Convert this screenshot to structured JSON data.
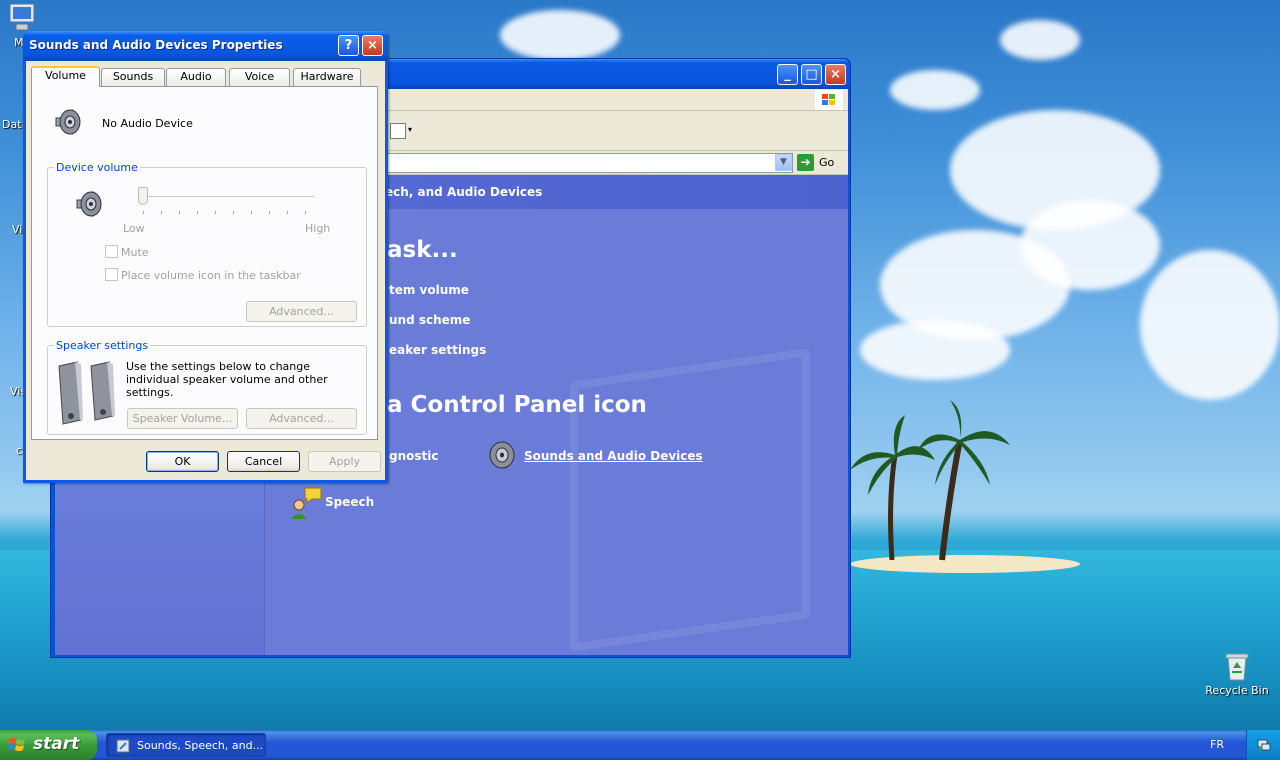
{
  "desktop": {
    "icons": [
      {
        "label": "My",
        "icon": "my-computer-icon"
      },
      {
        "label": "Dat",
        "icon": "data-icon"
      },
      {
        "label": "M\nVi",
        "icon": "folder-icon"
      },
      {
        "label": "M\nVis",
        "icon": "folder-icon"
      },
      {
        "label": "c",
        "icon": "shortcut-icon"
      }
    ],
    "recycle_bin": {
      "label": "Recycle Bin",
      "icon": "recycle-bin-icon"
    }
  },
  "control_panel": {
    "header": "ech, and Audio Devices",
    "pick_task_heading": "ask...",
    "tasks": [
      "tem volume",
      "und scheme",
      "eaker settings"
    ],
    "pick_icon_heading": "a Control Panel icon",
    "icons": [
      {
        "label": "gnostic",
        "icon": "diagnostic-icon"
      },
      {
        "label": "Sounds and Audio Devices",
        "icon": "speaker-icon"
      },
      {
        "label": "Speech",
        "icon": "speech-icon"
      }
    ],
    "address_go": "Go"
  },
  "dialog": {
    "title": "Sounds and Audio Devices Properties",
    "help_label": "?",
    "close_label": "×",
    "tabs": [
      {
        "label": "Volume",
        "active": true
      },
      {
        "label": "Sounds",
        "active": false
      },
      {
        "label": "Audio",
        "active": false
      },
      {
        "label": "Voice",
        "active": false
      },
      {
        "label": "Hardware",
        "active": false
      }
    ],
    "device_name": "No Audio Device",
    "device_volume": {
      "legend": "Device volume",
      "low_label": "Low",
      "high_label": "High",
      "value": 0,
      "mute_label": "Mute",
      "mute_checked": false,
      "taskbar_icon_label": "Place volume icon in the taskbar",
      "taskbar_icon_checked": false,
      "advanced_button": "Advanced..."
    },
    "speaker_settings": {
      "legend": "Speaker settings",
      "description": "Use the settings below to change individual speaker volume and other settings.",
      "speaker_volume_button": "Speaker Volume...",
      "advanced_button": "Advanced..."
    },
    "buttons": {
      "ok": "OK",
      "cancel": "Cancel",
      "apply": "Apply"
    }
  },
  "taskbar": {
    "start_label": "start",
    "tasks": [
      {
        "label": "Sounds, Speech, and..."
      }
    ],
    "language": "FR"
  },
  "colors": {
    "xp_blue_title": "#0a5ae6",
    "start_green": "#3c9e3c",
    "cp_background": "#6a7cd8",
    "dialog_face": "#ece9d8",
    "group_legend": "#0046d5"
  }
}
